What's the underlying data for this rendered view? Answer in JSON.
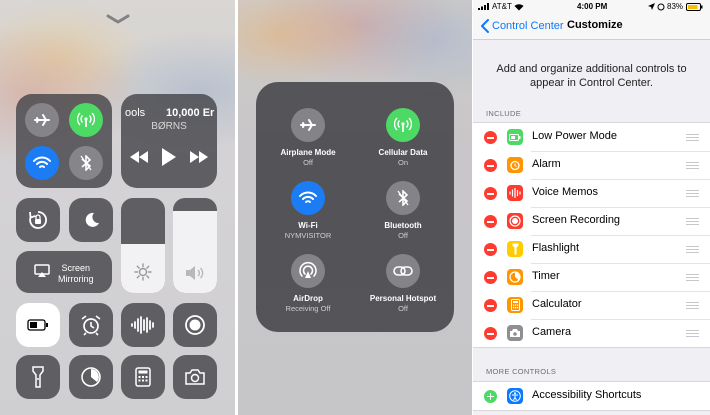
{
  "control_center": {
    "music": {
      "title": "ools",
      "time": "10,000 Er",
      "artist": "BØRNS"
    },
    "screen_mirroring": {
      "line1": "Screen",
      "line2": "Mirroring"
    }
  },
  "connectivity_expanded": {
    "airplane": {
      "label": "Airplane Mode",
      "status": "Off"
    },
    "cellular": {
      "label": "Cellular Data",
      "status": "On"
    },
    "wifi": {
      "label": "Wi-Fi",
      "status": "NYMVISITOR"
    },
    "bluetooth": {
      "label": "Bluetooth",
      "status": "Off"
    },
    "airdrop": {
      "label": "AirDrop",
      "status": "Receiving Off"
    },
    "hotspot": {
      "label": "Personal Hotspot",
      "status": "Off"
    }
  },
  "settings": {
    "status_bar": {
      "carrier": "AT&T",
      "time": "4:00 PM",
      "battery": "83%"
    },
    "back_label": "Control Center",
    "title": "Customize",
    "description": "Add and organize additional controls to appear in Control Center.",
    "include_header": "INCLUDE",
    "more_header": "MORE CONTROLS",
    "include": [
      {
        "label": "Low Power Mode",
        "color": "#4cd964",
        "icon": "battery-icon"
      },
      {
        "label": "Alarm",
        "color": "#ff9500",
        "icon": "alarm-icon"
      },
      {
        "label": "Voice Memos",
        "color": "#ff3b30",
        "icon": "waveform-icon"
      },
      {
        "label": "Screen Recording",
        "color": "#ff3b30",
        "icon": "record-icon"
      },
      {
        "label": "Flashlight",
        "color": "#ffcc00",
        "icon": "flashlight-icon"
      },
      {
        "label": "Timer",
        "color": "#ff9500",
        "icon": "timer-icon"
      },
      {
        "label": "Calculator",
        "color": "#ff9500",
        "icon": "calculator-icon"
      },
      {
        "label": "Camera",
        "color": "#8e8e93",
        "icon": "camera-icon"
      }
    ],
    "more": [
      {
        "label": "Accessibility Shortcuts",
        "color": "#0a7aff",
        "icon": "accessibility-icon"
      }
    ]
  }
}
